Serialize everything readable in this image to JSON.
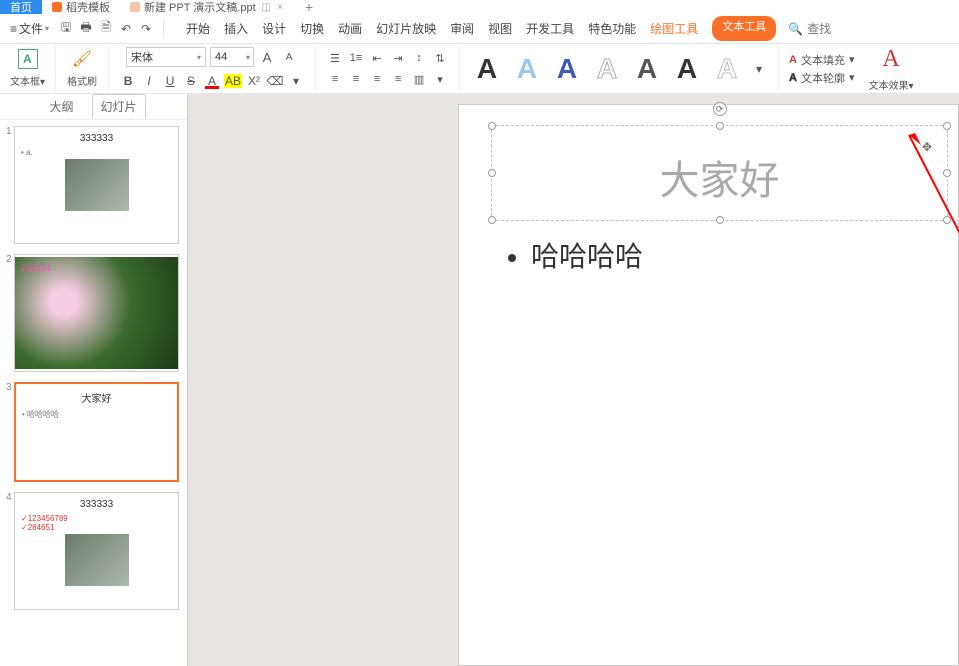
{
  "tabs": {
    "home": "首页",
    "docktpl": "稻壳模板",
    "newfile": "新建 PPT 演示文稿.ppt",
    "pin": "◫",
    "close": "×",
    "plus": "+"
  },
  "qat": {
    "file": "文件",
    "save": "🖫",
    "print": "🖶",
    "preview": "🗎",
    "undo": "↶",
    "redo": "↷"
  },
  "menu": {
    "start": "开始",
    "insert": "插入",
    "design": "设计",
    "transition": "切换",
    "animation": "动画",
    "slideshow": "幻灯片放映",
    "review": "审阅",
    "view": "视图",
    "developer": "开发工具",
    "special": "特色功能",
    "drawtools": "绘图工具",
    "texttools": "文本工具",
    "search": "查找"
  },
  "ribbon": {
    "textbox": "文本框",
    "formatpainter": "格式刷",
    "font_name": "宋体",
    "font_size": "44",
    "increase": "A",
    "decrease": "A",
    "bold": "B",
    "italic": "I",
    "underline": "U",
    "strike": "S",
    "fontcolor": "A",
    "highlight": "AB",
    "wordart": "A",
    "text_fill": "文本填充",
    "text_outline": "文本轮廓",
    "text_effects": "文本效果"
  },
  "panel": {
    "outline": "大纲",
    "slides": "幻灯片"
  },
  "thumbs": {
    "s1_title": "333333",
    "s2_overlay": "222224",
    "s3_title": "大家好",
    "s3_bullet": "哈哈哈哈",
    "s4_title": "333333",
    "s4_line1": "123456789",
    "s4_line2": "284651"
  },
  "slide": {
    "title": "大家好",
    "bullet1": "哈哈哈哈"
  }
}
